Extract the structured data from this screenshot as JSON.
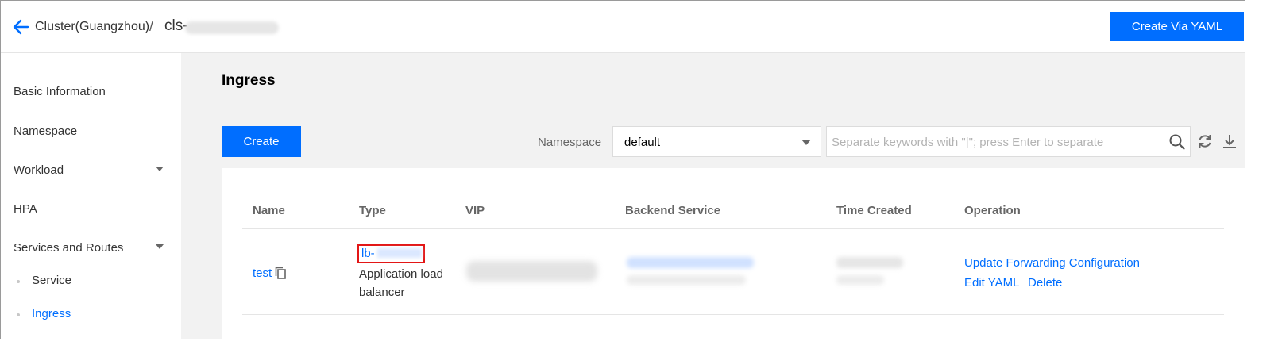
{
  "header": {
    "breadcrumb": "Cluster(Guangzhou)",
    "separator": "/",
    "cluster_prefix": "cls-",
    "create_yaml_button": "Create Via YAML"
  },
  "sidebar": {
    "items": [
      {
        "label": "Basic Information",
        "expandable": false
      },
      {
        "label": "Namespace",
        "expandable": false
      },
      {
        "label": "Workload",
        "expandable": true
      },
      {
        "label": "HPA",
        "expandable": false
      },
      {
        "label": "Services and Routes",
        "expandable": true
      }
    ],
    "sub_items": [
      {
        "label": "Service",
        "active": false
      },
      {
        "label": "Ingress",
        "active": true
      }
    ]
  },
  "main": {
    "title": "Ingress",
    "create_button": "Create",
    "namespace_label": "Namespace",
    "namespace_value": "default",
    "search_placeholder": "Separate keywords with \"|\"; press Enter to separate",
    "columns": [
      "Name",
      "Type",
      "VIP",
      "Backend Service",
      "Time Created",
      "Operation"
    ],
    "row": {
      "name": "test",
      "type_link": "lb-",
      "type_text": "Application load balancer",
      "operations": [
        "Update Forwarding Configuration",
        "Edit YAML",
        "Delete"
      ]
    }
  },
  "colors": {
    "primary": "#006eff",
    "highlight_border": "#e31616",
    "main_background": "#f2f2f2"
  },
  "icons": [
    "back-arrow-icon",
    "search-icon",
    "refresh-icon",
    "download-icon",
    "copy-icon",
    "chevron-down-icon"
  ]
}
